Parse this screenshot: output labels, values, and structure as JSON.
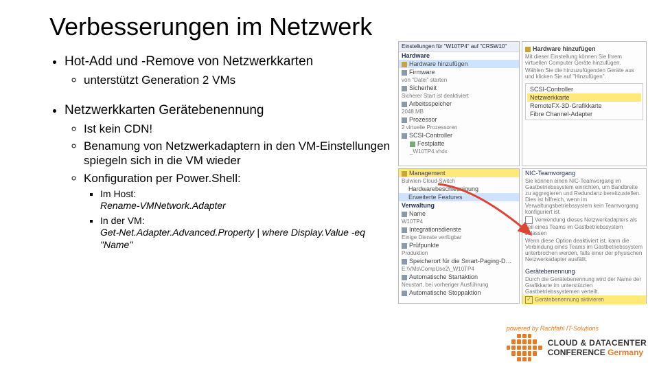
{
  "title": "Verbesserungen im Netzwerk",
  "bullets": {
    "b1": "Hot-Add und -Remove von Netzwerkkarten",
    "b1a": "unterstützt Generation 2 VMs",
    "b2": "Netzwerkkarten Gerätebenennung",
    "b2a": "Ist kein CDN!",
    "b2b": "Benamung von Netzwerkadaptern in den VM-Einstellungen spiegeln sich in die VM wieder",
    "b2c": "Konfiguration per Power.Shell:",
    "b2c1_label": "Im Host:",
    "b2c1_code": "Rename-VMNetwork.Adapter",
    "b2c2_label": "In der VM:",
    "b2c2_code": "Get-Net.Adapter.Advanced.Property | where Display.Value -eq \"Name\""
  },
  "shotA": {
    "bar": "Einstellungen für \"W10TP4\" auf \"CRSW10\"",
    "hw": "Hardware",
    "add": "Hardware hinzufügen",
    "fw": "Firmware",
    "fw_sub": "von \"Datei\" starten",
    "sec": "Sicherheit",
    "sec_sub": "Sicherer Start ist deaktiviert",
    "mem": "Arbeitsspeicher",
    "mem_sub": "2048 MB",
    "cpu": "Prozessor",
    "cpu_sub": "2 virtuelle Prozessoren",
    "scsi": "SCSI-Controller",
    "hdd": "Festplatte",
    "hdd_sub": "_W10TP4.vhdx"
  },
  "shotB": {
    "add": "Hardware hinzufügen",
    "txt1": "Mit dieser Einstellung können Sie Ihrem virtuellen Computer Geräte hinzufügen.",
    "txt2": "Wählen Sie die hinzuzufügenden Geräte aus und klicken Sie auf \"Hinzufügen\".",
    "opt1": "SCSI-Controller",
    "opt2": "Netzwerkkarte",
    "opt3": "RemoteFX-3D-Grafikkarte",
    "opt4": "Fibre Channel-Adapter"
  },
  "shotC": {
    "mgmt": "Management",
    "mgmt_sub": "Bulwien-Cloud-Switch",
    "hwacc": "Hardwarebeschleunigung",
    "erw": "Erweiterte Features",
    "verw": "Verwaltung",
    "name": "Name",
    "name_v": "W10TP4",
    "int": "Integrationsdienste",
    "int_sub": "Einige Dienste verfügbar",
    "chk": "Prüfpunkte",
    "chk_sub": "Produktion",
    "sp": "Speicherort für die Smart-Paging-D…",
    "sp_sub": "E:\\VMs\\CompUse2\\_W10TP4",
    "auto": "Automatische Startaktion",
    "auto_sub": "Neustart, bei vorheriger Ausführung",
    "stop": "Automatische Stoppaktion"
  },
  "shotD": {
    "team": "NIC-Teamvorgang",
    "txt1": "Sie können einen NIC-Teamvorgang im Gastbetriebssystem einrichten, um Bandbreite zu aggregieren und Redundanz bereitzustellen. Dies ist hilfreich, wenn im Verwaltungsbetriebssystem kein Teamvorgang konfiguriert ist.",
    "chk1": "Verwendung dieses Netzwerkadapters als Teil eines Teams im Gastbetriebssystem zulassen",
    "txt2": "Wenn diese Option deaktiviert ist, kann die Verbindung eines Teams im Gastbetriebssystem unterbrochen werden, falls einer der physischen Netzwerkadapter ausfällt.",
    "gb": "Gerätebenennung",
    "txt3": "Durch die Gerätebenennung wird der Name der Grafikkarte im unterstützten Gastbetriebssystemen verteilt.",
    "chk2": "Gerätebenennung aktivieren"
  },
  "footer": {
    "powered": "powered by Rachfahl IT-Solutions",
    "l1": "CLOUD & DATACENTER",
    "l2a": "CONFERENCE ",
    "l2b": "Germany"
  }
}
